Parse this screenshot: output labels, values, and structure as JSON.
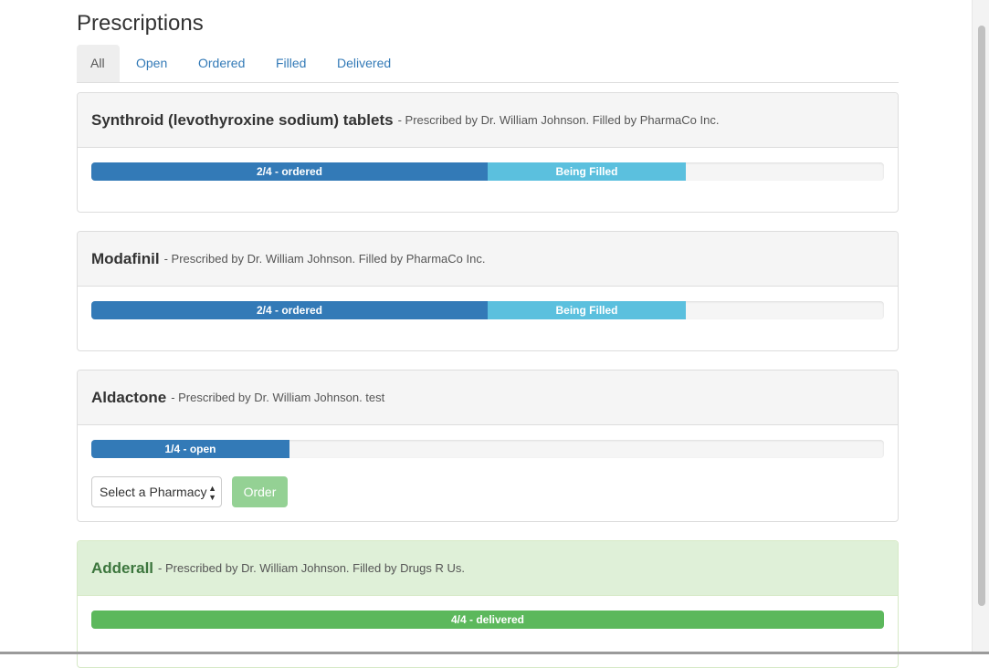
{
  "page": {
    "title": "Prescriptions"
  },
  "tabs": [
    {
      "label": "All",
      "active": true
    },
    {
      "label": "Open",
      "active": false
    },
    {
      "label": "Ordered",
      "active": false
    },
    {
      "label": "Filled",
      "active": false
    },
    {
      "label": "Delivered",
      "active": false
    }
  ],
  "prescriptions": [
    {
      "name": "Synthroid (levothyroxine sodium) tablets",
      "details": "- Prescribed by Dr. William Johnson. Filled by PharmaCo Inc.",
      "progress": [
        {
          "label": "2/4 - ordered",
          "fraction": 0.5,
          "style": "primary"
        },
        {
          "label": "Being Filled",
          "fraction": 0.25,
          "style": "info"
        }
      ]
    },
    {
      "name": "Modafinil",
      "details": "- Prescribed by Dr. William Johnson. Filled by PharmaCo Inc.",
      "progress": [
        {
          "label": "2/4 - ordered",
          "fraction": 0.5,
          "style": "primary"
        },
        {
          "label": "Being Filled",
          "fraction": 0.25,
          "style": "info"
        }
      ]
    },
    {
      "name": "Aldactone",
      "details": "- Prescribed by Dr. William Johnson. test",
      "progress": [
        {
          "label": "1/4 - open",
          "fraction": 0.25,
          "style": "primary"
        }
      ],
      "pharmacy_select": "Select a Pharmacy",
      "order_button": "Order"
    },
    {
      "name": "Adderall",
      "details": "- Prescribed by Dr. William Johnson. Filled by Drugs R Us.",
      "progress": [
        {
          "label": "4/4 - delivered",
          "fraction": 1.0,
          "style": "success"
        }
      ]
    }
  ],
  "colors": {
    "primary": "#337ab7",
    "info": "#5bc0de",
    "success": "#5cb85c",
    "order_button_disabled": "#94d194"
  }
}
